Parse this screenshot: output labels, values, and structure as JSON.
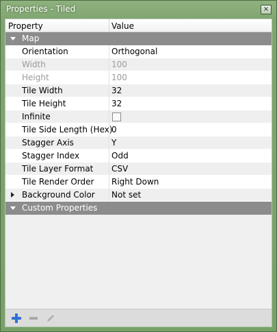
{
  "window": {
    "title": "Properties - Tiled",
    "close_glyph": "×"
  },
  "header": {
    "property_col": "Property",
    "value_col": "Value"
  },
  "groups": {
    "map": {
      "label": "Map"
    },
    "custom": {
      "label": "Custom Properties"
    }
  },
  "rows": [
    {
      "name": "Orientation",
      "value": "Orthogonal"
    },
    {
      "name": "Width",
      "value": "100"
    },
    {
      "name": "Height",
      "value": "100"
    },
    {
      "name": "Tile Width",
      "value": "32"
    },
    {
      "name": "Tile Height",
      "value": "32"
    },
    {
      "name": "Infinite",
      "value": ""
    },
    {
      "name": "Tile Side Length (Hex)",
      "value": "0"
    },
    {
      "name": "Stagger Axis",
      "value": "Y"
    },
    {
      "name": "Stagger Index",
      "value": "Odd"
    },
    {
      "name": "Tile Layer Format",
      "value": "CSV"
    },
    {
      "name": "Tile Render Order",
      "value": "Right Down"
    },
    {
      "name": "Background Color",
      "value": "Not set"
    }
  ],
  "toolbar": {
    "add_icon": "plus-icon",
    "remove_icon": "minus-icon",
    "rename_icon": "pencil-icon"
  },
  "colors": {
    "window_frame": "#7fa56f",
    "group_header": "#8c8c8c",
    "add_icon": "#2f6fd6"
  }
}
